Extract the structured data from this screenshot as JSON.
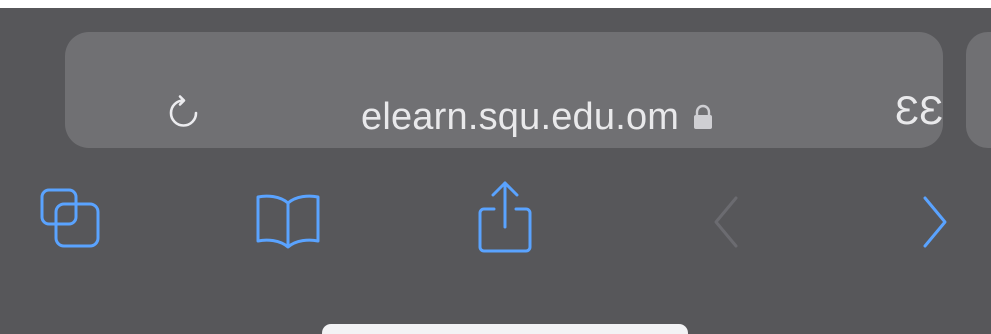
{
  "browser": {
    "url": "elearn.squ.edu.om",
    "reader_label": "ع ع",
    "reader_label_display": "ƐƐ",
    "icons": {
      "reload": "reload-icon",
      "lock": "lock-icon",
      "tabs": "tabs-icon",
      "bookmarks": "bookmarks-icon",
      "share": "share-icon",
      "back": "back-chevron-icon",
      "forward": "forward-chevron-icon"
    },
    "colors": {
      "background": "#57575a",
      "address_bar": "#707073",
      "text": "#e9e9eb",
      "accent": "#5aa3ff",
      "disabled": "#6b6b70",
      "home_indicator": "#f3f3f5"
    }
  }
}
